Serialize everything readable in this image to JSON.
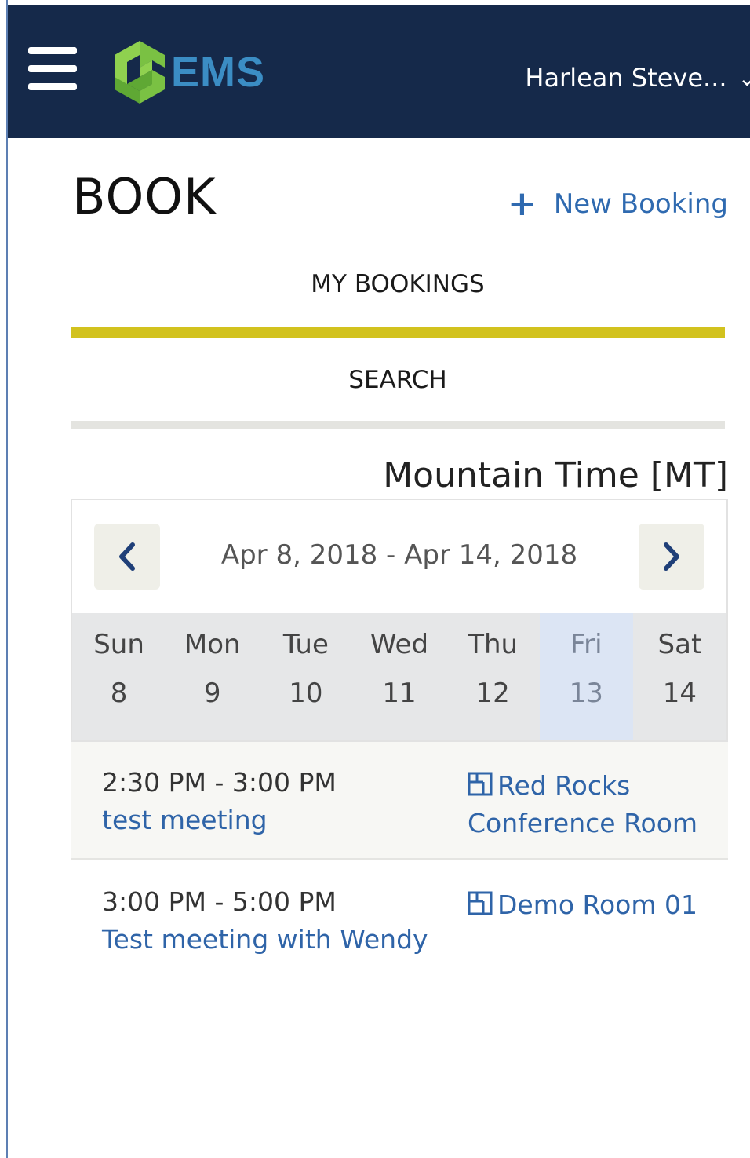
{
  "header": {
    "logo_text": "EMS",
    "user_name": "Harlean Steve...",
    "colors": {
      "bar": "#15294a",
      "logo_green": "#7ac143",
      "logo_blue": "#3b8dc4"
    }
  },
  "page": {
    "title": "BOOK",
    "new_booking_label": "New Booking"
  },
  "tabs": [
    {
      "label": "MY BOOKINGS",
      "active": true,
      "accent": "#d2c21e"
    },
    {
      "label": "SEARCH",
      "active": false
    }
  ],
  "calendar": {
    "timezone": "Mountain Time [MT]",
    "range": "Apr 8, 2018 - Apr 14, 2018",
    "prev_icon": "chevron-left-icon",
    "next_icon": "chevron-right-icon",
    "days": [
      {
        "name": "Sun",
        "date": "8"
      },
      {
        "name": "Mon",
        "date": "9"
      },
      {
        "name": "Tue",
        "date": "10"
      },
      {
        "name": "Wed",
        "date": "11"
      },
      {
        "name": "Thu",
        "date": "12"
      },
      {
        "name": "Fri",
        "date": "13",
        "selected": true
      },
      {
        "name": "Sat",
        "date": "14"
      }
    ]
  },
  "bookings": [
    {
      "time": "2:30 PM - 3:00 PM",
      "title": "test meeting",
      "room": "Red Rocks Conference Room",
      "room_icon": "room-icon"
    },
    {
      "time": "3:00 PM - 5:00 PM",
      "title": "Test meeting with Wendy",
      "room": "Demo Room 01",
      "room_icon": "room-icon"
    }
  ]
}
